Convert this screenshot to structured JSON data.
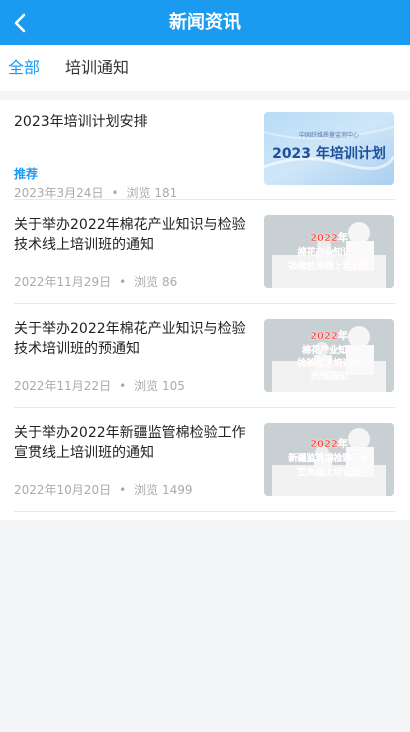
{
  "header": {
    "title": "新闻资讯",
    "back_icon": "chevron-left-icon"
  },
  "tabs": [
    {
      "label": "全部",
      "active": true
    },
    {
      "label": "培训通知",
      "active": false
    }
  ],
  "items": [
    {
      "title": "2023年培训计划安排",
      "tag": "推荐",
      "date": "2023年3月24日",
      "views": "浏览 181",
      "thumb": {
        "small_text": "中国纤维质量监测中心",
        "main_text": "2023 年培训计划"
      }
    },
    {
      "title": "关于举办2022年棉花产业知识与检验技术线上培训班的通知",
      "date": "2022年11月29日",
      "views": "浏览 86",
      "thumb": {
        "lines": [
          "2022年",
          "棉花产业知识与",
          "检验技术线上培训班"
        ]
      }
    },
    {
      "title": "关于举办2022年棉花产业知识与检验技术培训班的预通知",
      "date": "2022年11月22日",
      "views": "浏览 105",
      "thumb": {
        "lines": [
          "2022年",
          "棉花产业知识",
          "检验技术培训班",
          "的预通知"
        ]
      }
    },
    {
      "title": "关于举办2022年新疆监管棉检验工作宣贯线上培训班的通知",
      "date": "2022年10月20日",
      "views": "浏览 1499",
      "thumb": {
        "lines": [
          "2022年",
          "新疆监管棉检验工作",
          "宣贯线上培训班"
        ]
      }
    }
  ],
  "meta_separator": "•",
  "colors": {
    "primary": "#1a9bf0",
    "thumb_text": "#ff3b30"
  }
}
